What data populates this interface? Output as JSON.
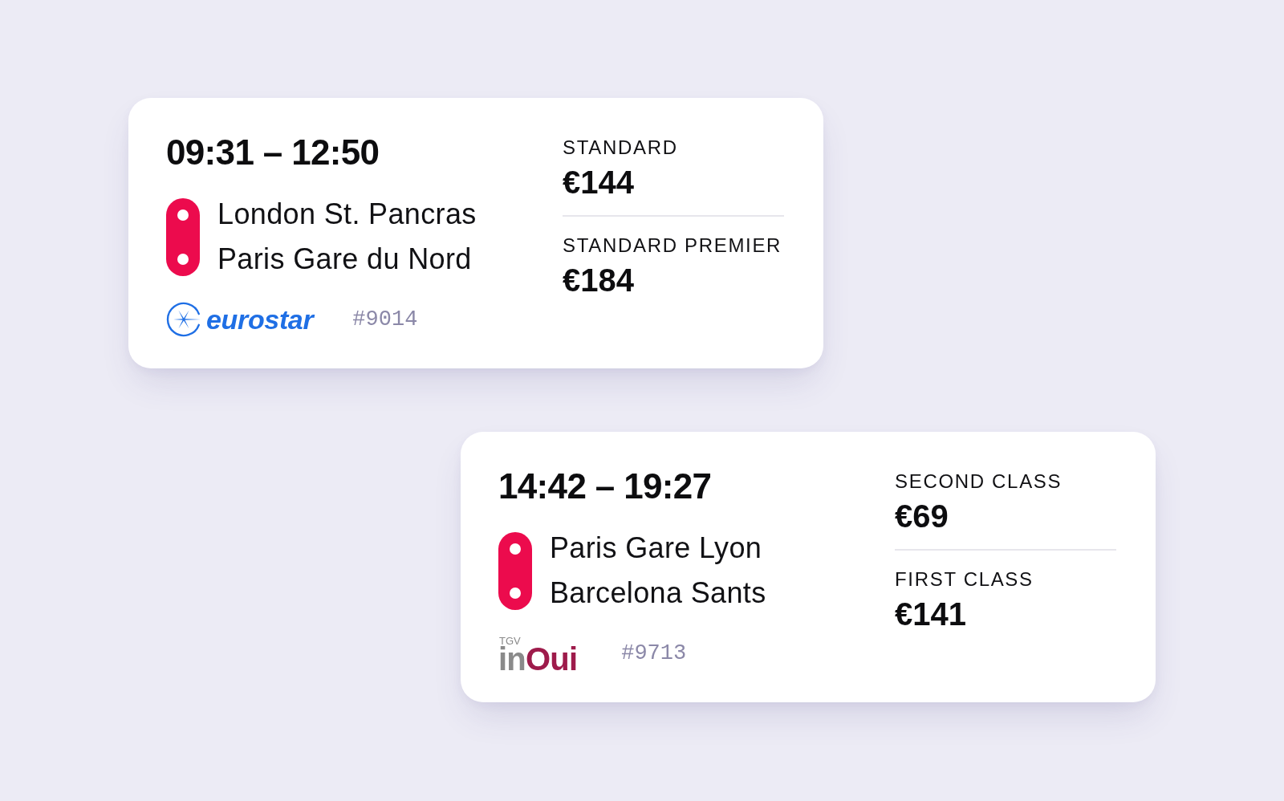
{
  "journeys": [
    {
      "times": "09:31 – 12:50",
      "stops": [
        "London St. Pancras",
        "Paris Gare du Nord"
      ],
      "operator": {
        "kind": "eurostar",
        "wordmark": [
          {
            "text": "eurostar",
            "color": "#1f6fe5"
          }
        ]
      },
      "train_number": "#9014",
      "fares": [
        {
          "class": "STANDARD",
          "price": "€144"
        },
        {
          "class": "STANDARD PREMIER",
          "price": "€184"
        }
      ]
    },
    {
      "times": "14:42 – 19:27",
      "stops": [
        "Paris Gare Lyon",
        "Barcelona Sants"
      ],
      "operator": {
        "kind": "inoui",
        "tag": "TGV",
        "wordmark": [
          {
            "text": "in",
            "color": "#8a8a8a"
          },
          {
            "text": "Oui",
            "color": "#9e1b4b"
          }
        ]
      },
      "train_number": "#9713",
      "fares": [
        {
          "class": "SECOND CLASS",
          "price": "€69"
        },
        {
          "class": "FIRST CLASS",
          "price": "€141"
        }
      ]
    }
  ]
}
